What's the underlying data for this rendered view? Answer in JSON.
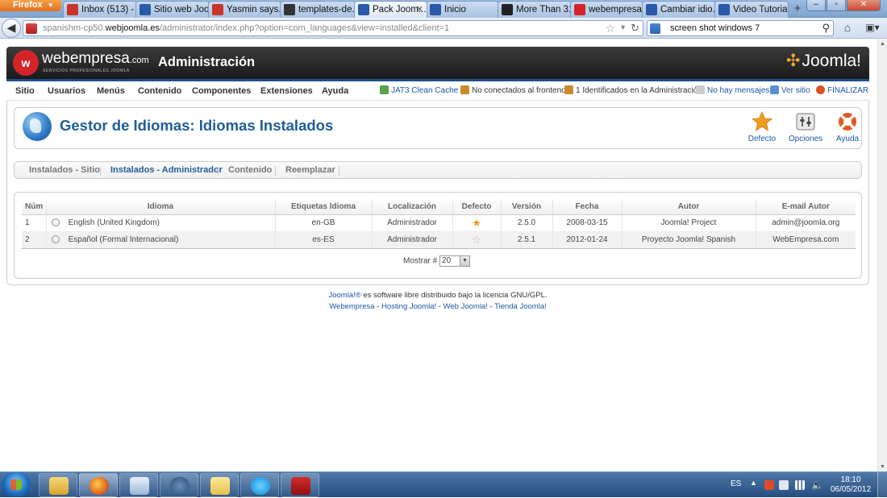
{
  "browser": {
    "menu_button": "Firefox",
    "tabs": [
      {
        "label": "Inbox (513) - ...",
        "icon_color": "#c9352b"
      },
      {
        "label": "Sitio web Joo...",
        "icon_color": "#2a5aa8"
      },
      {
        "label": "Yasmin says...",
        "icon_color": "#c9352b"
      },
      {
        "label": "templates-de...",
        "icon_color": "#333333"
      },
      {
        "label": "Pack Joom...",
        "icon_color": "#2a5aa8"
      },
      {
        "label": "Inicio",
        "icon_color": "#2a5aa8"
      },
      {
        "label": "More Than 31...",
        "icon_color": "#222222"
      },
      {
        "label": "webempresa ...",
        "icon_color": "#d4242a"
      },
      {
        "label": "Cambiar idio...",
        "icon_color": "#2a5aa8"
      },
      {
        "label": "Video Tutorial...",
        "icon_color": "#2a5aa8"
      }
    ],
    "active_tab": 4,
    "url_prefix": "spanishm-cp50.",
    "url_domain": "webjoomla.es",
    "url_suffix": "/administrator/index.php?option=com_languages&view=installed&client=1",
    "search_text": "screen shot windows 7"
  },
  "header": {
    "brand": "webempresa",
    "brand_suffix": ".com",
    "brand_tagline": "SERVICIOS PROFESIONALES JOOMLA",
    "title": "Administración",
    "cms_logo": "Joomla!"
  },
  "menu": {
    "items": [
      "Sitio",
      "Usuarios",
      "Menús",
      "Contenido",
      "Componentes",
      "Extensiones",
      "Ayuda"
    ],
    "status": {
      "cache": "JAT3 Clean Cache",
      "frontend": "No conectados al frontend",
      "admin": "1 Identificados en la Administración",
      "messages": "No hay mensajes",
      "view_site": "Ver sitio",
      "logout": "FINALIZAR"
    }
  },
  "toolbar": {
    "title": "Gestor de Idiomas: Idiomas Instalados",
    "default_label": "Defecto",
    "options_label": "Opciones",
    "help_label": "Ayuda"
  },
  "subnav": {
    "tabs": [
      "Instalados - Sitio",
      "Instalados - Administrador",
      "Contenido",
      "Reemplazar"
    ],
    "active": 1
  },
  "table": {
    "headers": [
      "Núm",
      "Idioma",
      "Etiquetas Idioma",
      "Localización",
      "Defecto",
      "Versión",
      "Fecha",
      "Autor",
      "E-mail Autor"
    ],
    "rows": [
      {
        "num": "1",
        "language": "English (United Kingdom)",
        "tag": "en-GB",
        "location": "Administrador",
        "default": true,
        "version": "2.5.0",
        "date": "2008-03-15",
        "author": "Joomla! Project",
        "email": "admin@joomla.org"
      },
      {
        "num": "2",
        "language": "Español (Formal Internacional)",
        "tag": "es-ES",
        "location": "Administrador",
        "default": false,
        "version": "2.5.1",
        "date": "2012-01-24",
        "author": "Proyecto Joomla! Spanish",
        "email": "WebEmpresa.com"
      }
    ],
    "pager_label": "Mostrar #",
    "pager_value": "20"
  },
  "footer": {
    "joomla_link": "Joomla!®",
    "license_text": " es software libre distribuido bajo la licencia GNU/GPL.",
    "links": [
      "Webempresa",
      "Hosting Joomla!",
      "Web Joomla!",
      "Tienda Joomla!"
    ],
    "separator": " - "
  },
  "taskbar": {
    "language": "ES",
    "time": "18:10",
    "date": "06/05/2012"
  }
}
